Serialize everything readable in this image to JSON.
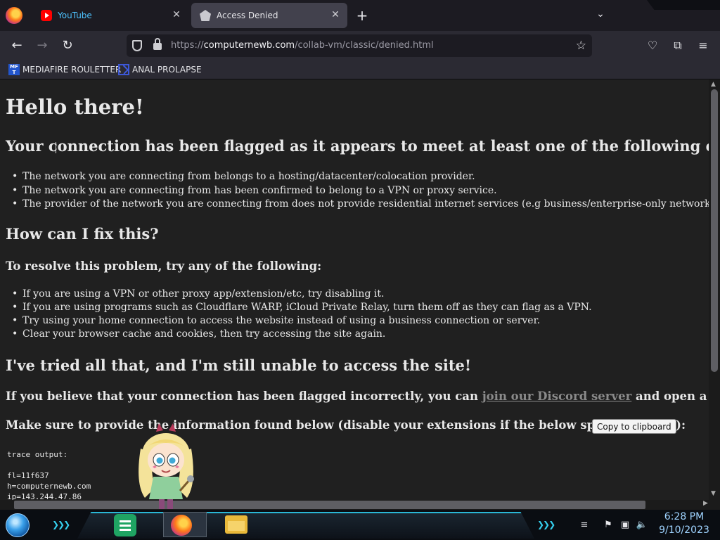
{
  "browser": {
    "tabs": [
      {
        "title": "YouTube",
        "icon": "youtube-icon",
        "active": false,
        "color": "#4dc3ff"
      },
      {
        "title": "Access Denied",
        "icon": "mask-icon",
        "active": true
      }
    ],
    "url": {
      "prefix": "https://",
      "domain": "computernewb.com",
      "path": "/collab-vm/classic/denied.html"
    },
    "bookmarks": [
      {
        "label": "MEDIAFIRE ROULETTER",
        "icon": "mediafire-icon",
        "icon_text": "MF\nT"
      },
      {
        "label": "ANAL PROLAPSE",
        "icon": "bookmark-sigma-icon"
      }
    ]
  },
  "page": {
    "heading": "Hello there!",
    "flagged_heading": "Your connection has been flagged as it appears to meet at least one of the following criteria:",
    "criteria": [
      "The network you are connecting from belongs to a hosting/datacenter/colocation provider.",
      "The network you are connecting from has been confirmed to belong to a VPN or proxy service.",
      "The provider of the network you are connecting from does not provide residential internet services (e.g business/enterprise-only networks)."
    ],
    "fix_heading": "How can I fix this?",
    "resolve_heading": "To resolve this problem, try any of the following:",
    "fixes": [
      "If you are using a VPN or other proxy app/extension/etc, try disabling it.",
      "If you are using programs such as Cloudflare WARP, iCloud Private Relay, turn them off as they can flag as a VPN.",
      "Try using your home connection to access the website instead of using a business connection or server.",
      "Clear your browser cache and cookies, then try accessing the site again."
    ],
    "still_heading": "I've tried all that, and I'm still unable to access the site!",
    "discord_prefix": "If you believe that your connection has been flagged incorrectly, you can ",
    "discord_link": "join our Discord server",
    "discord_suffix": " and open a ticket.",
    "provide_text": "Make sure to provide the information found below (disable your extensions if the below space is empty):",
    "copy_button": "Copy to clipboard",
    "trace": {
      "label": "trace output:",
      "lines": [
        "fl=11f637",
        "h=computernewb.com",
        "ip=143.244.47.86"
      ]
    }
  },
  "taskbar": {
    "time": "6:28 PM",
    "date": "9/10/2023",
    "apps": [
      "spreadsheet-app-icon",
      "firefox-app-icon",
      "file-explorer-icon"
    ],
    "accent_color": "#2ab7d6"
  }
}
